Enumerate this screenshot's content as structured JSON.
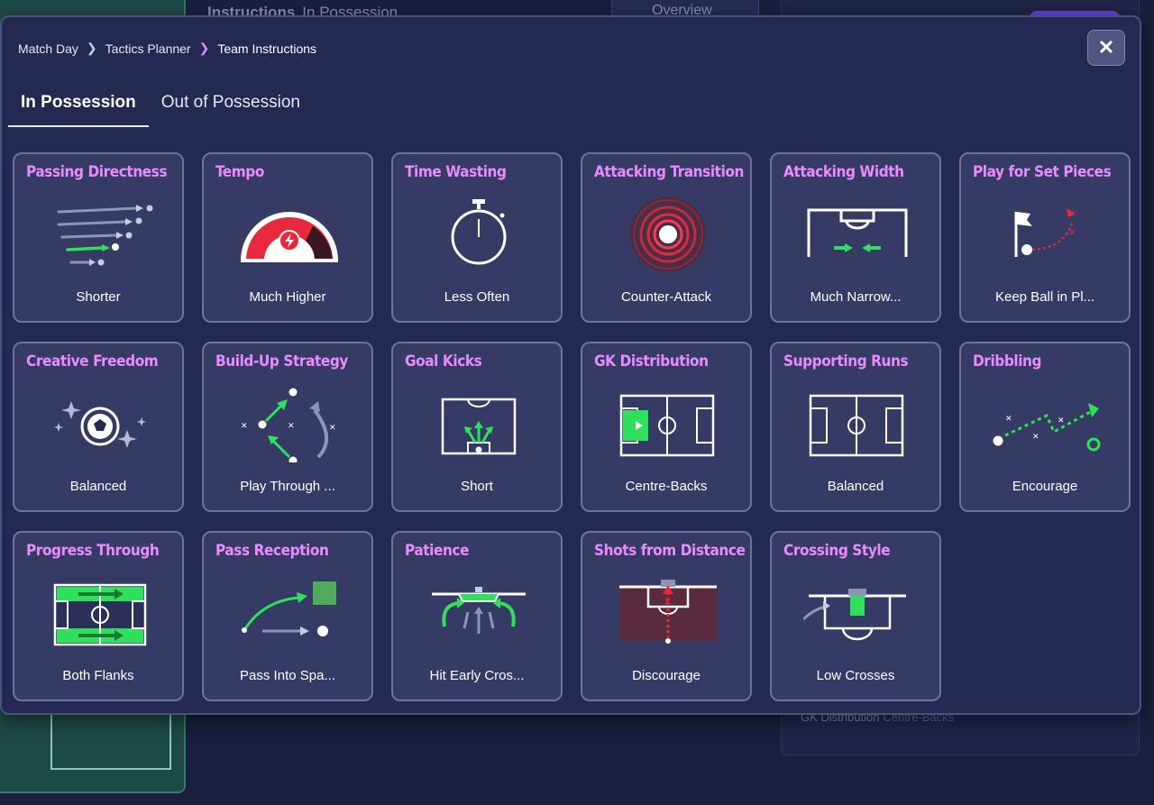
{
  "background": {
    "header_title": "Instructions",
    "header_subtitle": "In Possession",
    "overview_label": "Overview",
    "gk_line_label": "GK Distribution",
    "gk_line_value": "Centre-Backs"
  },
  "breadcrumb": [
    "Match Day",
    "Tactics Planner",
    "Team Instructions"
  ],
  "close_label": "✕",
  "tabs": [
    {
      "label": "In Possession",
      "active": true
    },
    {
      "label": "Out of Possession",
      "active": false
    }
  ],
  "colors": {
    "accent_title": "#e98bff",
    "accent_green": "#2ee05a",
    "accent_red": "#e8283c",
    "card_bg": "#353b64"
  },
  "cards": [
    {
      "title": "Passing Directness",
      "value": "Shorter",
      "icon": "passing-directness-icon"
    },
    {
      "title": "Tempo",
      "value": "Much Higher",
      "icon": "tempo-gauge-icon"
    },
    {
      "title": "Time Wasting",
      "value": "Less Often",
      "icon": "stopwatch-icon"
    },
    {
      "title": "Attacking Transition",
      "value": "Counter-Attack",
      "icon": "counter-attack-icon"
    },
    {
      "title": "Attacking Width",
      "value": "Much Narrow...",
      "icon": "attacking-width-icon"
    },
    {
      "title": "Play for Set Pieces",
      "value": "Keep Ball in Pl...",
      "icon": "set-pieces-flag-icon"
    },
    {
      "title": "Creative Freedom",
      "value": "Balanced",
      "icon": "creative-freedom-ball-icon"
    },
    {
      "title": "Build-Up Strategy",
      "value": "Play Through ...",
      "icon": "build-up-strategy-icon"
    },
    {
      "title": "Goal Kicks",
      "value": "Short",
      "icon": "goal-kicks-icon"
    },
    {
      "title": "GK Distribution",
      "value": "Centre-Backs",
      "icon": "gk-distribution-pitch-icon"
    },
    {
      "title": "Supporting Runs",
      "value": "Balanced",
      "icon": "supporting-runs-pitch-icon"
    },
    {
      "title": "Dribbling",
      "value": "Encourage",
      "icon": "dribbling-icon"
    },
    {
      "title": "Progress Through",
      "value": "Both Flanks",
      "icon": "progress-through-flanks-icon"
    },
    {
      "title": "Pass Reception",
      "value": "Pass Into Spa...",
      "icon": "pass-reception-icon"
    },
    {
      "title": "Patience",
      "value": "Hit Early Cros...",
      "icon": "patience-icon"
    },
    {
      "title": "Shots from Distance",
      "value": "Discourage",
      "icon": "shots-from-distance-icon"
    },
    {
      "title": "Crossing Style",
      "value": "Low Crosses",
      "icon": "crossing-style-icon"
    }
  ]
}
